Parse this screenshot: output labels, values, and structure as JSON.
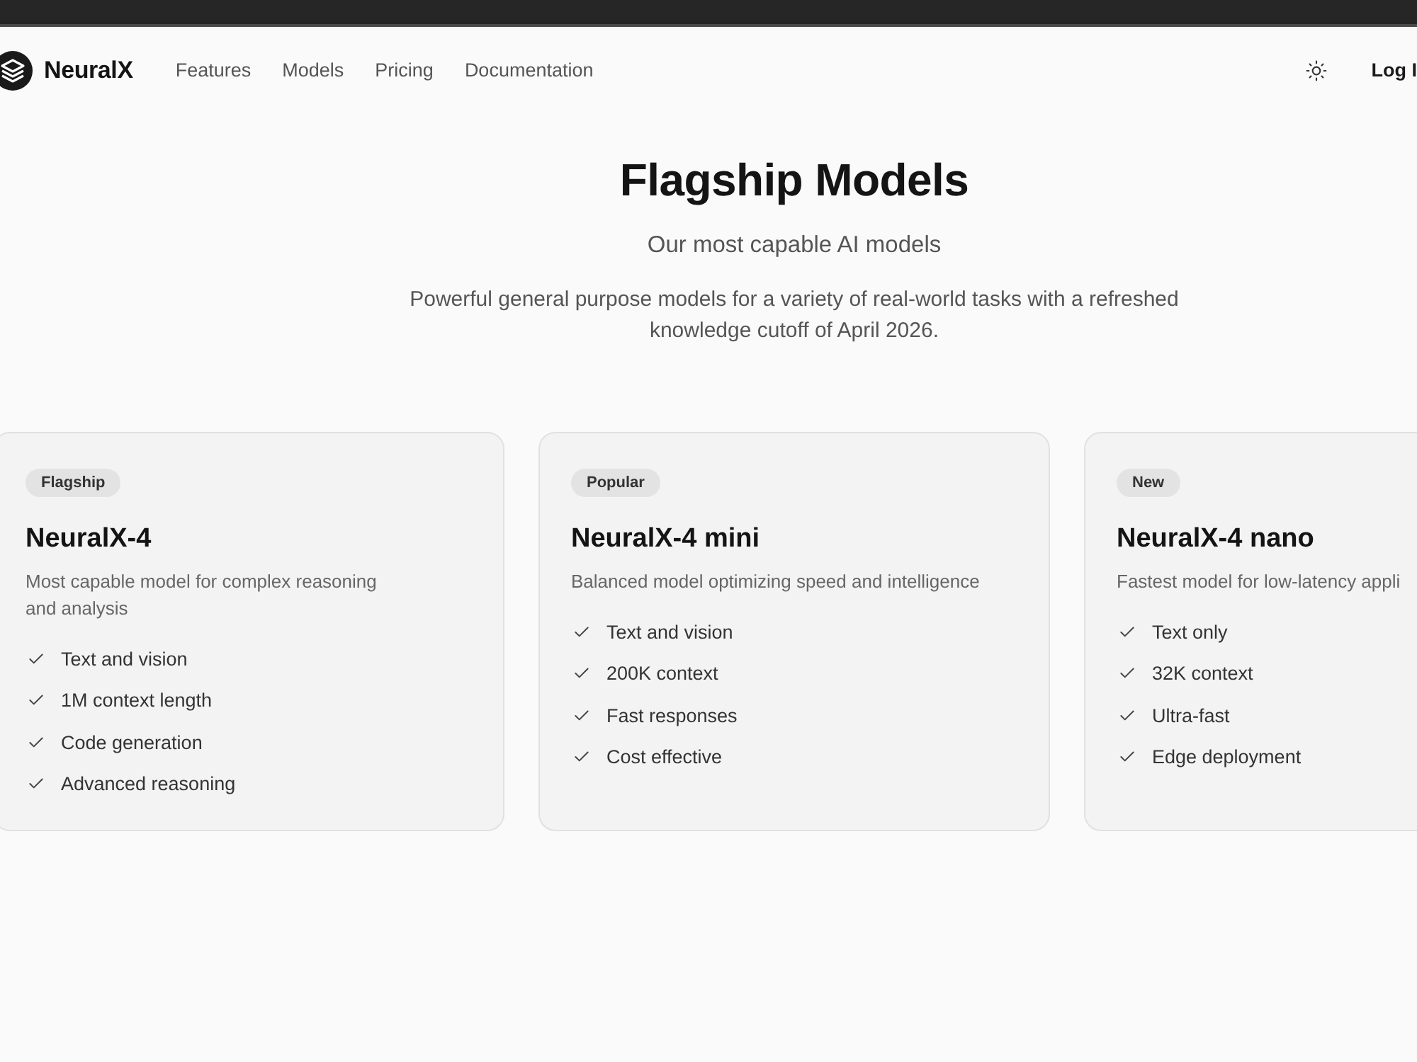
{
  "nav": {
    "logo": "NeuralX",
    "links": [
      {
        "label": "Features"
      },
      {
        "label": "Models"
      },
      {
        "label": "Pricing"
      },
      {
        "label": "Documentation"
      }
    ],
    "login": "Log I"
  },
  "hero": {
    "title": "Flagship Models",
    "subtitle": "Our most capable AI models",
    "description_lines": [
      "Powerful general purpose models for a variety of real-world tasks with a refreshed",
      "knowledge cutoff of April 2026."
    ]
  },
  "cards": [
    {
      "badge": "Flagship",
      "name": "NeuralX-4",
      "description_lines": [
        "Most capable model for complex reasoning",
        "and analysis"
      ],
      "features": [
        "Text and vision",
        "1M context length",
        "Code generation",
        "Advanced reasoning"
      ]
    },
    {
      "badge": "Popular",
      "name": "NeuralX-4 mini",
      "description_lines": [
        "Balanced model optimizing speed and intelligence"
      ],
      "features": [
        "Text and vision",
        "200K context",
        "Fast responses",
        "Cost effective"
      ]
    },
    {
      "badge": "New",
      "name": "NeuralX-4 nano",
      "description_lines": [
        "Fastest model for low-latency appli"
      ],
      "features": [
        "Text only",
        "32K context",
        "Ultra-fast",
        "Edge deployment"
      ]
    }
  ]
}
